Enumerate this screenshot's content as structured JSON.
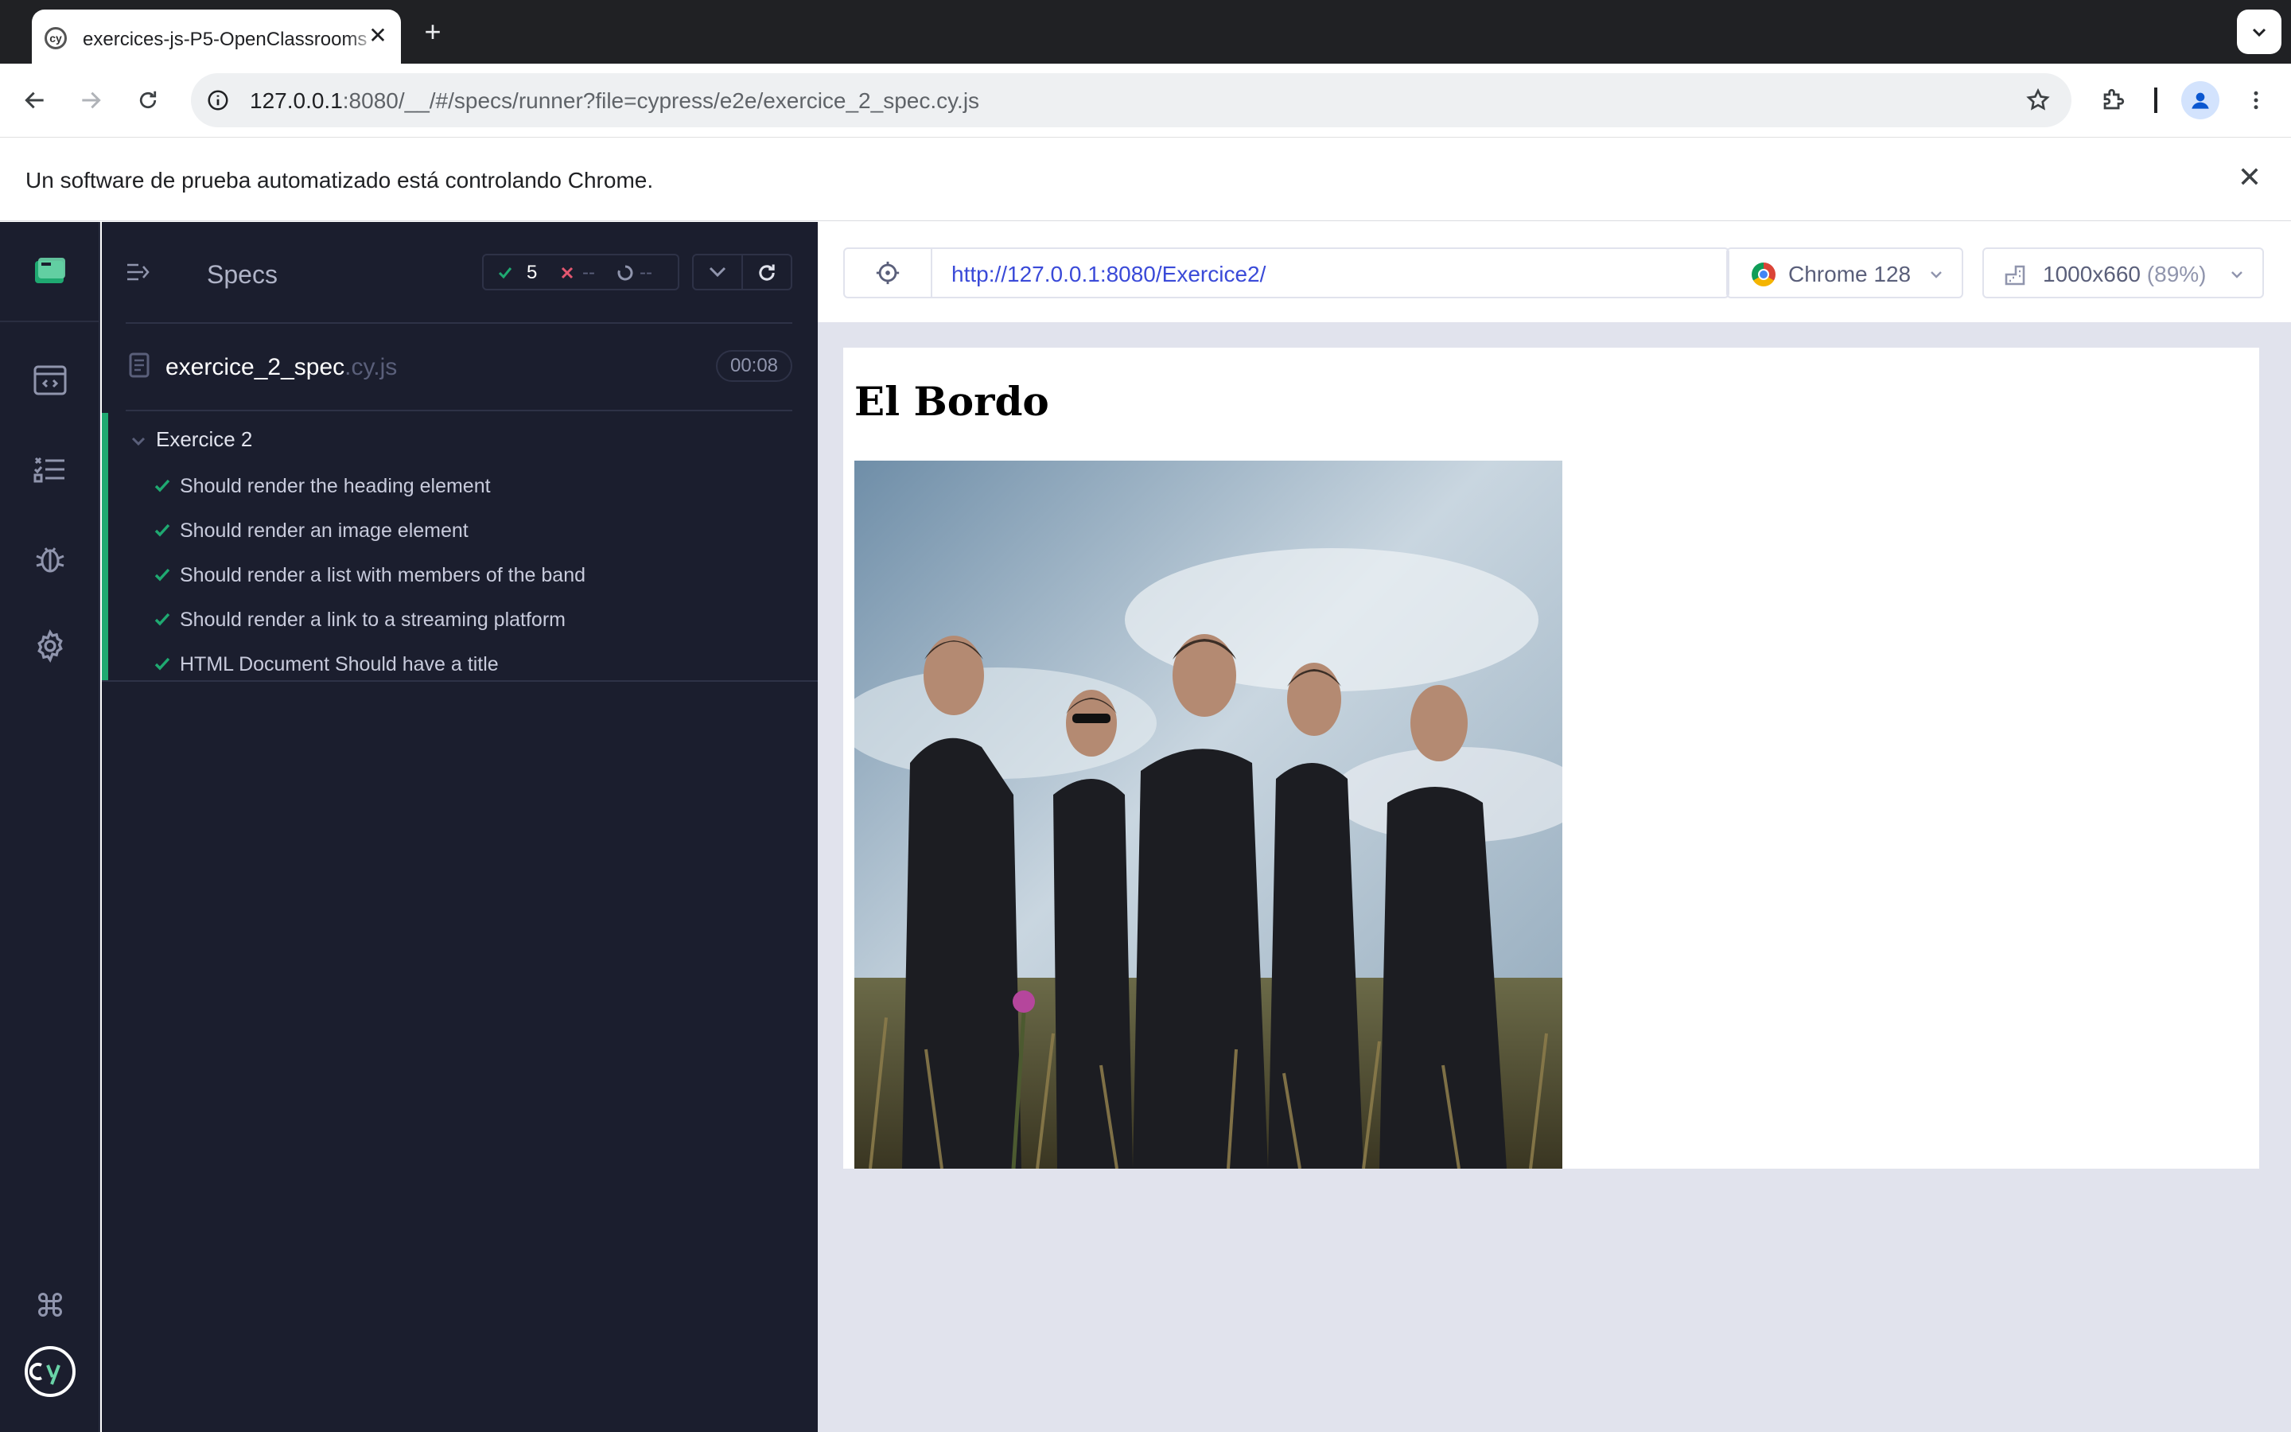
{
  "browser": {
    "tab_title": "exercices-js-P5-OpenClassrooms",
    "tab_close": "✕",
    "new_tab": "+",
    "url_host": "127.0.0.1",
    "url_rest": ":8080/__/#/specs/runner?file=cypress/e2e/exercice_2_spec.cy.js",
    "infobar_text": "Un software de prueba automatizado está controlando Chrome.",
    "infobar_close": "✕"
  },
  "reporter": {
    "header": "Specs",
    "stats": {
      "passed": "5",
      "failed": "--",
      "pending": "--"
    },
    "spec_file": {
      "name": "exercice_2_spec",
      "ext": ".cy.js",
      "duration": "00:08"
    },
    "suite": {
      "title": "Exercice 2",
      "tests": [
        {
          "label": "Should render the heading element",
          "state": "passed"
        },
        {
          "label": "Should render an image element",
          "state": "passed"
        },
        {
          "label": "Should render a list with members of the band",
          "state": "passed"
        },
        {
          "label": "Should render a link to a streaming platform",
          "state": "passed"
        },
        {
          "label": "HTML Document Should have a title",
          "state": "passed"
        }
      ]
    }
  },
  "preview": {
    "url": "http://127.0.0.1:8080/Exercice2/",
    "browser": "Chrome 128",
    "viewport": "1000x660",
    "scale": "(89%)"
  },
  "app": {
    "heading": "El Bordo"
  },
  "colors": {
    "pass": "#1fa971",
    "fail": "#e45770",
    "reporter_bg": "#1b1e2e",
    "preview_bg": "#e1e3ed",
    "url_link": "#3a4ad8"
  }
}
